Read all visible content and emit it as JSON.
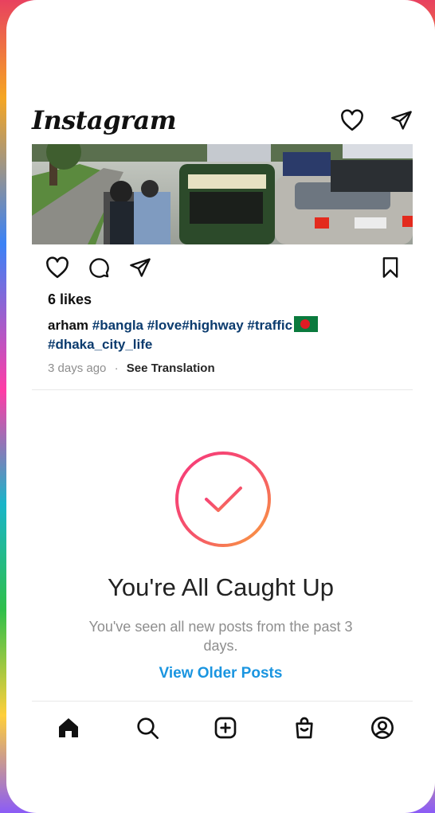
{
  "header": {
    "logo": "Instagram",
    "icons": [
      "heart-icon",
      "send-icon"
    ]
  },
  "post": {
    "image_alt": "traffic",
    "actions": [
      "heart-icon",
      "comment-icon",
      "share-icon",
      "bookmark-icon"
    ],
    "likes": "6 likes",
    "username": "arham",
    "hashtags": [
      "#bangla",
      "#love#highway",
      "#traffic",
      "#dhaka_city_life"
    ],
    "time": "3 days ago",
    "separator": "·",
    "translate": "See Translation"
  },
  "caught_up": {
    "title": "You're All Caught Up",
    "subtitle": "You've seen all new posts from the past 3 days.",
    "link": "View Older Posts"
  },
  "nav": {
    "items": [
      "home-icon",
      "search-icon",
      "add-post-icon",
      "shop-icon",
      "profile-icon"
    ],
    "active": "home-icon"
  },
  "colors": {
    "link_blue": "#1a95e0",
    "hashtag": "#0b3b6e",
    "check_gradient_start": "#f73a7a",
    "check_gradient_end": "#f9a23a"
  }
}
